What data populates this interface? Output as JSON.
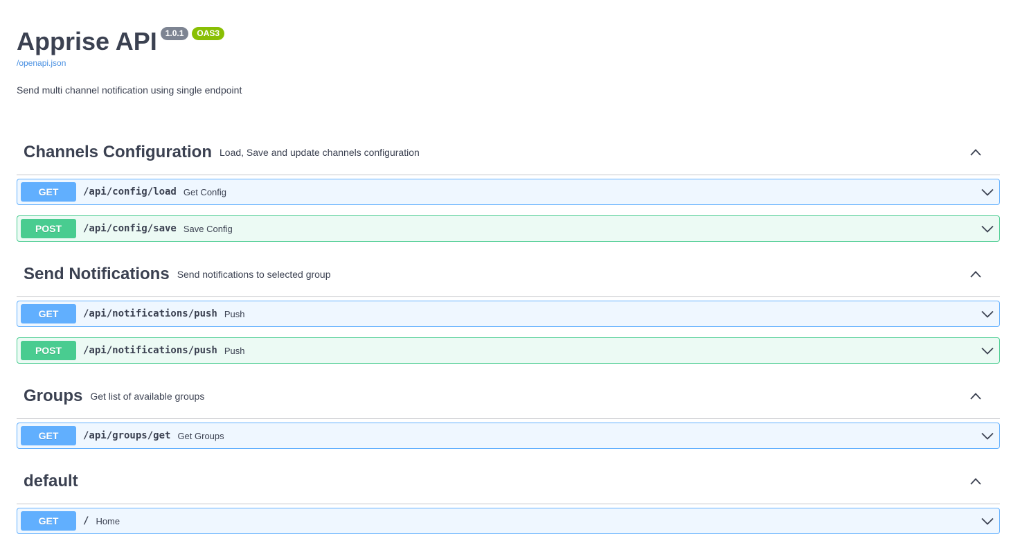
{
  "info": {
    "title": "Apprise API",
    "version": "1.0.1",
    "oas": "OAS3",
    "spec_link": "/openapi.json",
    "description": "Send multi channel notification using single endpoint"
  },
  "tags": [
    {
      "name": "Channels Configuration",
      "description": "Load, Save and update channels configuration",
      "operations": [
        {
          "method": "GET",
          "path": "/api/config/load",
          "summary": "Get Config"
        },
        {
          "method": "POST",
          "path": "/api/config/save",
          "summary": "Save Config"
        }
      ]
    },
    {
      "name": "Send Notifications",
      "description": "Send notifications to selected group",
      "operations": [
        {
          "method": "GET",
          "path": "/api/notifications/push",
          "summary": "Push"
        },
        {
          "method": "POST",
          "path": "/api/notifications/push",
          "summary": "Push"
        }
      ]
    },
    {
      "name": "Groups",
      "description": "Get list of available groups",
      "operations": [
        {
          "method": "GET",
          "path": "/api/groups/get",
          "summary": "Get Groups"
        }
      ]
    },
    {
      "name": "default",
      "description": "",
      "operations": [
        {
          "method": "GET",
          "path": "/",
          "summary": "Home"
        }
      ]
    }
  ],
  "colors": {
    "get": "#61affe",
    "post": "#49cc90",
    "version_badge": "#7d8492",
    "oas_badge": "#89bf04",
    "link": "#4990e2",
    "text": "#3b4151"
  },
  "icons": {
    "tag_toggle": "chevron-up-icon",
    "op_toggle": "chevron-down-icon"
  }
}
